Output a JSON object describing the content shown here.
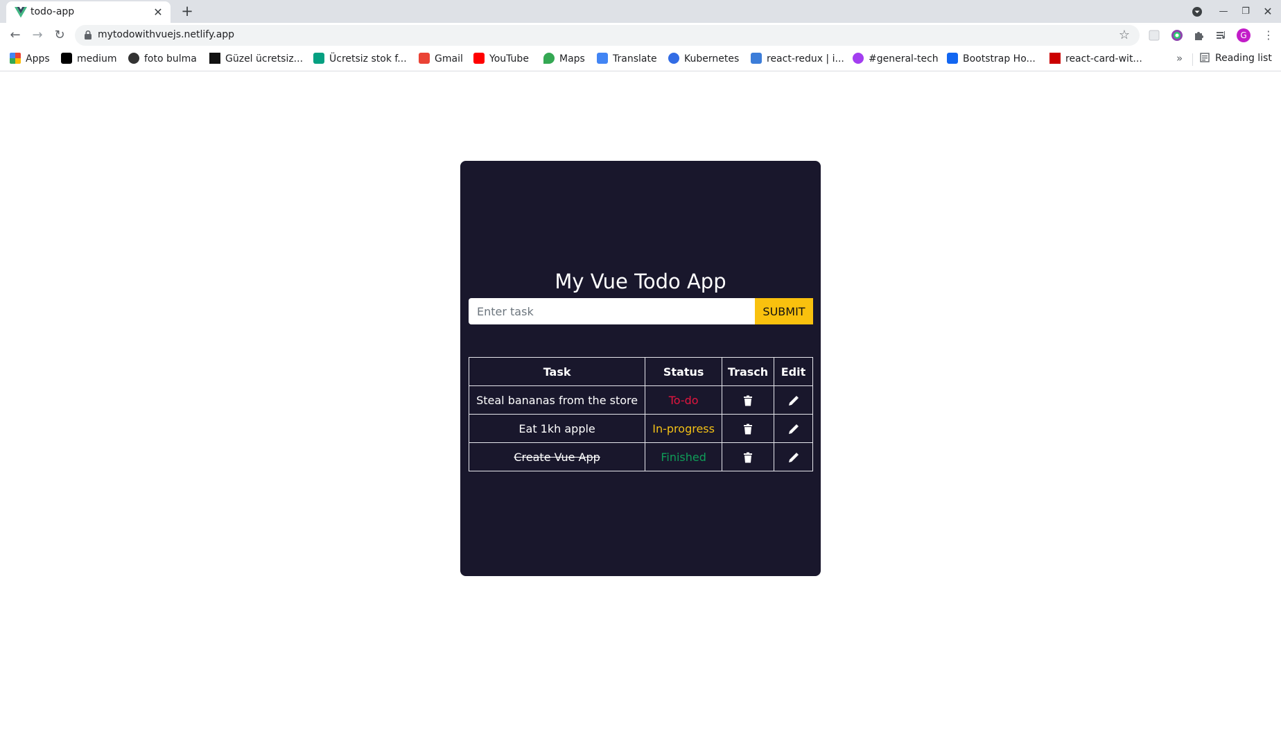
{
  "browser": {
    "tab": {
      "title": "todo-app"
    },
    "address": {
      "url": "mytodowithvuejs.netlify.app"
    },
    "bookmarks": [
      {
        "label": "Apps",
        "icon": "apps-grid-icon",
        "color": "#ea4335"
      },
      {
        "label": "medium",
        "icon": "medium-icon",
        "color": "#000000"
      },
      {
        "label": "foto bulma",
        "icon": "wordpress-icon",
        "color": "#333333"
      },
      {
        "label": "Güzel ücretsiz...",
        "icon": "unsplash-icon",
        "color": "#111111"
      },
      {
        "label": "Ücretsiz stok f...",
        "icon": "pexels-icon",
        "color": "#05a081"
      },
      {
        "label": "Gmail",
        "icon": "gmail-icon",
        "color": "#ea4335"
      },
      {
        "label": "YouTube",
        "icon": "youtube-icon",
        "color": "#ff0000"
      },
      {
        "label": "Maps",
        "icon": "maps-icon",
        "color": "#34a853"
      },
      {
        "label": "Translate",
        "icon": "translate-icon",
        "color": "#4285f4"
      },
      {
        "label": "Kubernetes",
        "icon": "kubernetes-icon",
        "color": "#326ce5"
      },
      {
        "label": "react-redux | i...",
        "icon": "react-redux-icon",
        "color": "#3c7dd9"
      },
      {
        "label": "#general-tech",
        "icon": "discord-icon",
        "color": "#a33ef0"
      },
      {
        "label": "Bootstrap Ho...",
        "icon": "mdb-icon",
        "color": "#1266f1"
      },
      {
        "label": "react-card-wit...",
        "icon": "npm-icon",
        "color": "#cb0000"
      }
    ],
    "reading_list": "Reading list"
  },
  "app": {
    "title": "My Vue Todo App",
    "input": {
      "placeholder": "Enter task",
      "value": ""
    },
    "submit_label": "SUBMIT",
    "table": {
      "headers": {
        "task": "Task",
        "status": "Status",
        "trash": "Trasch",
        "edit": "Edit"
      },
      "rows": [
        {
          "task": "Steal bananas from the store",
          "status": "To-do",
          "status_color": "#e3153f",
          "finished": false
        },
        {
          "task": "Eat 1kh apple",
          "status": "In-progress",
          "status_color": "#f3c116",
          "finished": false
        },
        {
          "task": "Create Vue App",
          "status": "Finished",
          "status_color": "#0f9d58",
          "finished": true
        }
      ]
    },
    "colors": {
      "card_bg": "#19172c",
      "accent": "#f9c10e"
    }
  }
}
